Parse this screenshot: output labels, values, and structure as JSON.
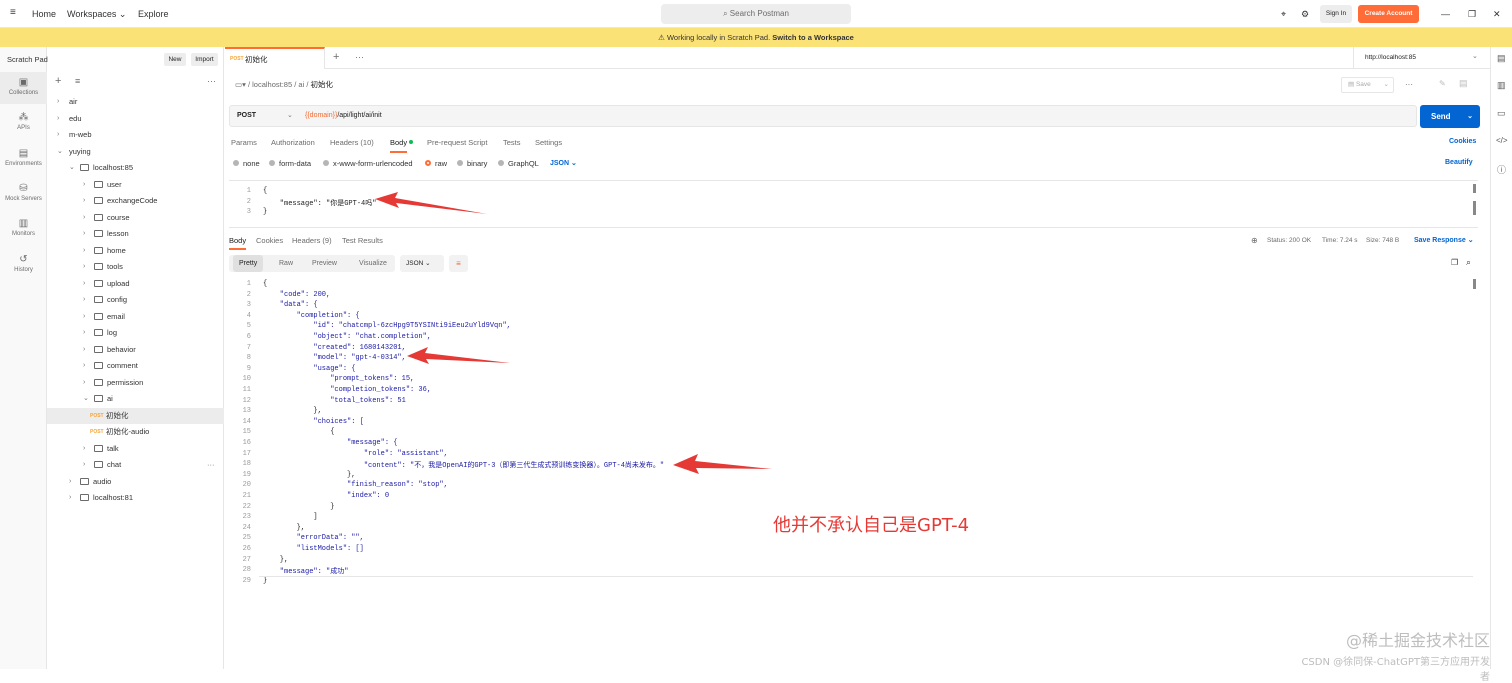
{
  "topbar": {
    "home": "Home",
    "workspaces": "Workspaces",
    "explore": "Explore",
    "search_placeholder": "Search Postman",
    "sign_in": "Sign In",
    "create_account": "Create Account"
  },
  "banner": {
    "text": "Working locally in Scratch Pad.",
    "link": "Switch to a Workspace"
  },
  "rail": {
    "items": [
      "Collections",
      "APIs",
      "Environments",
      "Mock Servers",
      "Monitors",
      "History"
    ]
  },
  "sidebar": {
    "title": "Scratch Pad",
    "new": "New",
    "import": "Import",
    "tree": [
      {
        "label": "air",
        "level": 0,
        "type": "folder"
      },
      {
        "label": "edu",
        "level": 0,
        "type": "folder"
      },
      {
        "label": "m-web",
        "level": 0,
        "type": "folder"
      },
      {
        "label": "yuying",
        "level": 0,
        "type": "folder-open"
      },
      {
        "label": "localhost:85",
        "level": 1,
        "type": "folder-open"
      },
      {
        "label": "user",
        "level": 2,
        "type": "folder"
      },
      {
        "label": "exchangeCode",
        "level": 2,
        "type": "folder"
      },
      {
        "label": "course",
        "level": 2,
        "type": "folder"
      },
      {
        "label": "lesson",
        "level": 2,
        "type": "folder"
      },
      {
        "label": "home",
        "level": 2,
        "type": "folder"
      },
      {
        "label": "tools",
        "level": 2,
        "type": "folder"
      },
      {
        "label": "upload",
        "level": 2,
        "type": "folder"
      },
      {
        "label": "config",
        "level": 2,
        "type": "folder"
      },
      {
        "label": "email",
        "level": 2,
        "type": "folder"
      },
      {
        "label": "log",
        "level": 2,
        "type": "folder"
      },
      {
        "label": "behavior",
        "level": 2,
        "type": "folder"
      },
      {
        "label": "comment",
        "level": 2,
        "type": "folder"
      },
      {
        "label": "permission",
        "level": 2,
        "type": "folder"
      },
      {
        "label": "ai",
        "level": 2,
        "type": "folder-open"
      },
      {
        "label": "初始化",
        "level": 3,
        "type": "request",
        "method": "POST"
      },
      {
        "label": "初始化-audio",
        "level": 3,
        "type": "request",
        "method": "POST"
      },
      {
        "label": "talk",
        "level": 2,
        "type": "folder"
      },
      {
        "label": "chat",
        "level": 2,
        "type": "folder"
      },
      {
        "label": "audio",
        "level": 1,
        "type": "folder"
      },
      {
        "label": "localhost:81",
        "level": 1,
        "type": "folder"
      }
    ]
  },
  "tabs": {
    "active_method": "POST",
    "active_label": "初始化",
    "env": "http://localhost:85"
  },
  "breadcrumb": {
    "host": "localhost:85",
    "folder": "ai",
    "item": "初始化"
  },
  "request": {
    "method": "POST",
    "url_var": "{{domain}}",
    "url_path": "/api/light/ai/init",
    "send": "Send",
    "save": "Save",
    "tabs": [
      "Params",
      "Authorization",
      "Headers (10)",
      "Body",
      "Pre-request Script",
      "Tests",
      "Settings"
    ],
    "cookies": "Cookies",
    "beautify": "Beautify",
    "body_types": [
      "none",
      "form-data",
      "x-www-form-urlencoded",
      "raw",
      "binary",
      "GraphQL"
    ],
    "format": "JSON",
    "body_lines": [
      "{",
      "    \"message\": \"你是GPT-4吗\"",
      "}"
    ]
  },
  "response": {
    "tabs": [
      "Body",
      "Cookies",
      "Headers (9)",
      "Test Results"
    ],
    "status": "Status: 200 OK",
    "time": "Time: 7.24 s",
    "size": "Size: 748 B",
    "save_response": "Save Response",
    "view_tabs": [
      "Pretty",
      "Raw",
      "Preview",
      "Visualize"
    ],
    "format": "JSON",
    "lines": [
      "{",
      "    \"code\": 200,",
      "    \"data\": {",
      "        \"completion\": {",
      "            \"id\": \"chatcmpl-6zcHpg9T5YSINti9iEeu2uYld9Vqn\",",
      "            \"object\": \"chat.completion\",",
      "            \"created\": 1680143201,",
      "            \"model\": \"gpt-4-0314\",",
      "            \"usage\": {",
      "                \"prompt_tokens\": 15,",
      "                \"completion_tokens\": 36,",
      "                \"total_tokens\": 51",
      "            },",
      "            \"choices\": [",
      "                {",
      "                    \"message\": {",
      "                        \"role\": \"assistant\",",
      "                        \"content\": \"不，我是OpenAI的GPT-3（即第三代生成式预训练变换器）。GPT-4尚未发布。\"",
      "                    },",
      "                    \"finish_reason\": \"stop\",",
      "                    \"index\": 0",
      "                }",
      "            ]",
      "        },",
      "        \"errorData\": \"\",",
      "        \"listModels\": []",
      "    },",
      "    \"message\": \"成功\"",
      "}"
    ]
  },
  "annotation": {
    "text": "他并不承认自己是GPT-4",
    "color": "#e53935"
  },
  "watermark": {
    "line1": "@稀土掘金技术社区",
    "line2": "CSDN @徐同保-ChatGPT第三方应用开发者"
  },
  "colors": {
    "send": "#0265d2",
    "create": "#ff6c37",
    "banner": "#fbe277",
    "arrow": "#e53935"
  }
}
